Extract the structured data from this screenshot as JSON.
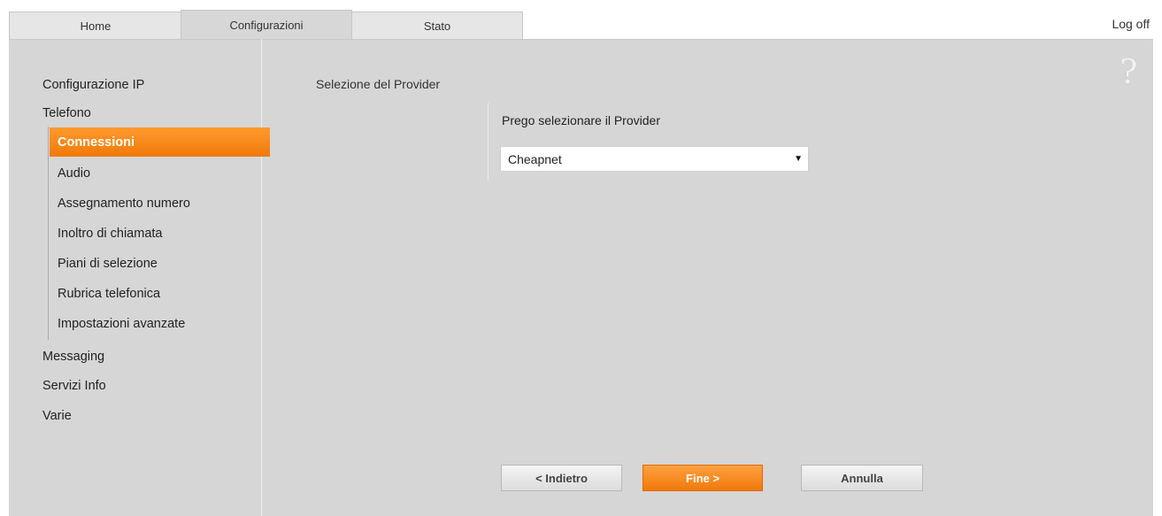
{
  "tabs": {
    "home": "Home",
    "config": "Configurazioni",
    "stato": "Stato"
  },
  "header": {
    "logoff": "Log off",
    "help": "?"
  },
  "sidebar": {
    "config_ip": "Configurazione IP",
    "telefono": "Telefono",
    "sub_items": {
      "connessioni": "Connessioni",
      "audio": "Audio",
      "assegnamento": "Assegnamento numero",
      "inoltro": "Inoltro di chiamata",
      "piani": "Piani di selezione",
      "rubrica": "Rubrica telefonica",
      "impostazioni": "Impostazioni avanzate"
    },
    "messaging": "Messaging",
    "servizi": "Servizi Info",
    "varie": "Varie"
  },
  "content": {
    "section_title": "Selezione del Provider",
    "prompt": "Prego selezionare il Provider",
    "provider_selected": "Cheapnet"
  },
  "buttons": {
    "back": "< Indietro",
    "finish": "Fine >",
    "cancel": "Annulla"
  },
  "colors": {
    "accent": "#f58a1e",
    "panel": "#d6d6d6"
  }
}
